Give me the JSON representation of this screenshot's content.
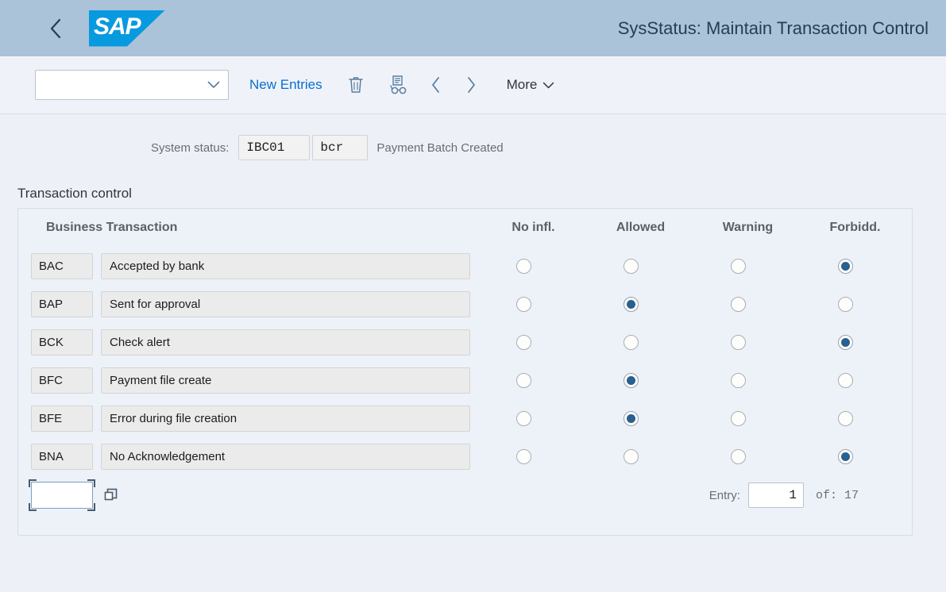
{
  "shell": {
    "back_icon": "chevron-left-icon",
    "logo_text": "SAP",
    "title": "SysStatus: Maintain Transaction Control"
  },
  "toolbar": {
    "select_value": "",
    "new_entries_label": "New Entries",
    "delete_icon": "trash-icon",
    "display_icon": "document-glasses-icon",
    "prev_icon": "chevron-left-icon",
    "next_icon": "chevron-right-icon",
    "more_label": "More",
    "more_icon": "chevron-down-icon"
  },
  "status": {
    "label": "System status:",
    "code": "IBC01",
    "short": "bcr",
    "description": "Payment Batch Created"
  },
  "section": {
    "title": "Transaction control"
  },
  "table": {
    "headers": {
      "business_transaction": "Business Transaction",
      "no_infl": "No infl.",
      "allowed": "Allowed",
      "warning": "Warning",
      "forbidden": "Forbidd."
    },
    "rows": [
      {
        "code": "BAC",
        "description": "Accepted by bank",
        "selected": 3
      },
      {
        "code": "BAP",
        "description": "Sent for approval",
        "selected": 1
      },
      {
        "code": "BCK",
        "description": "Check alert",
        "selected": 3
      },
      {
        "code": "BFC",
        "description": "Payment file create",
        "selected": 1
      },
      {
        "code": "BFE",
        "description": "Error during file creation",
        "selected": 1
      },
      {
        "code": "BNA",
        "description": "No Acknowledgement",
        "selected": 3
      }
    ],
    "new_row": {
      "value": "",
      "copy_icon": "copy-icon"
    },
    "footer": {
      "entry_label": "Entry:",
      "entry_value": "1",
      "of_label": "of: 17"
    }
  },
  "colors": {
    "shell_header": "#abc3d8",
    "brand_blue": "#089adf",
    "link_blue": "#0a6ed1",
    "radio_selected": "#28608f",
    "page_bg": "#edf1f7"
  }
}
